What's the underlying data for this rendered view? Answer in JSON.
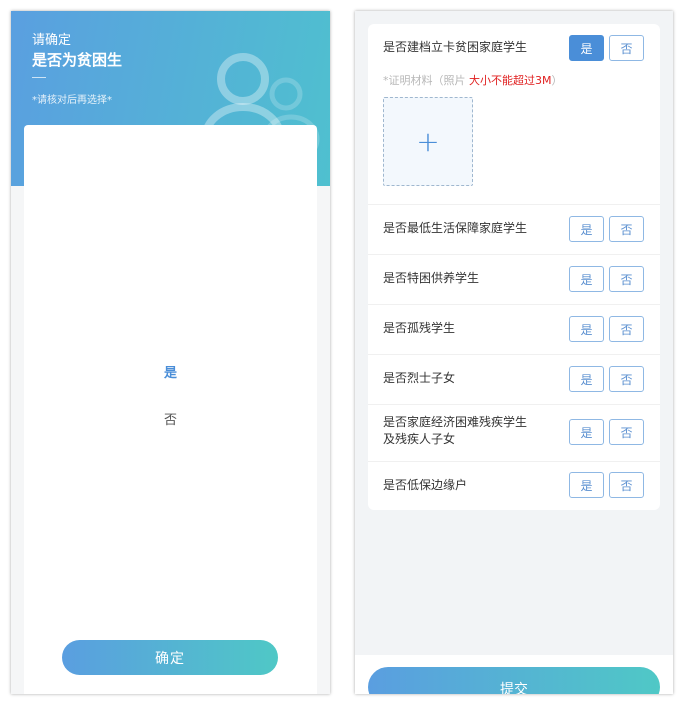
{
  "left": {
    "header": {
      "title_line1": "请确定",
      "title_line2": "是否为贫困生",
      "hint": "*请核对后再选择*"
    },
    "options": {
      "yes": "是",
      "no": "否"
    },
    "confirm_label": "确定"
  },
  "right": {
    "rows": [
      {
        "label": "是否建档立卡贫困家庭学生",
        "yes": "是",
        "no": "否",
        "selected": "yes"
      },
      {
        "label": "是否最低生活保障家庭学生",
        "yes": "是",
        "no": "否"
      },
      {
        "label": "是否特困供养学生",
        "yes": "是",
        "no": "否"
      },
      {
        "label": "是否孤残学生",
        "yes": "是",
        "no": "否"
      },
      {
        "label": "是否烈士子女",
        "yes": "是",
        "no": "否"
      },
      {
        "label_line1": "是否家庭经济困难残疾学生",
        "label_line2": "及残疾人子女",
        "yes": "是",
        "no": "否"
      },
      {
        "label": "是否低保边缘户",
        "yes": "是",
        "no": "否"
      }
    ],
    "proof": {
      "prefix": "*证明材料（照片 ",
      "warning": "大小不能超过3M",
      "suffix": "）",
      "upload_icon": "plus-icon"
    },
    "submit_label": "提交"
  },
  "colors": {
    "accent": "#4a8ed8",
    "gradient_start": "#5a9ee0",
    "gradient_end": "#4fc8c6",
    "warning": "#e02020"
  }
}
